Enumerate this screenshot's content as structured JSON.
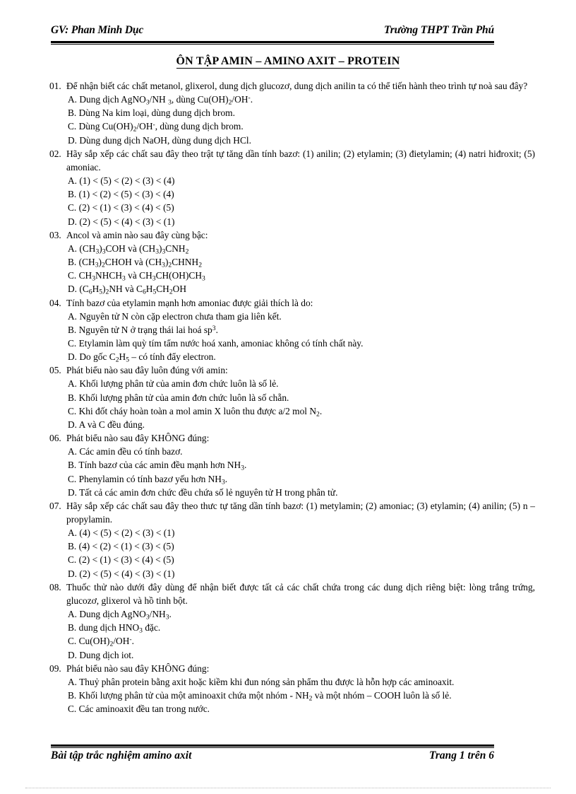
{
  "header": {
    "left": "GV: Phan Minh Dục",
    "right": "Trường THPT Trần Phú"
  },
  "title": "ÔN TẬP AMIN – AMINO AXIT – PROTEIN",
  "footer": {
    "left": "Bài tập trắc nghiệm amino axit",
    "right": "Trang 1 trên 6"
  },
  "questions": [
    {
      "num": "01.",
      "stem": "Để nhận biết các chất metanol,  glixerol,   dung  dịch glucozơ,  dung  dịch anilin  ta có thể tiến  hành theo trình tự noà sau đây?",
      "options": [
        "A. Dung dịch AgNO<sub>3</sub>/NH  <sub>3</sub>, dùng Cu(OH)<sub>2</sub>/OH<sup>-</sup>.",
        "B.  Dùng Na kim loại, dùng dung dịch brom.",
        "C. Dùng Cu(OH)<sub>2</sub>/OH<sup>-</sup>, dùng dung dịch brom.",
        "D. Dùng dung dịch NaOH, dùng dung dịch HCl."
      ]
    },
    {
      "num": "02.",
      "stem": "Hãy sắp xếp các chất sau đây theo trật tự tăng dần tính bazơ: (1) anilin;  (2) etylamin;  (3) đietylamin;   (4) natri hiđroxit;  (5) amoniac.",
      "options": [
        "A. (1) &lt; (5) &lt; (2) &lt; (3) &lt; (4)",
        "B. (1) &lt; (2) &lt; (5) &lt; (3) &lt; (4)",
        "C. (2) &lt; (1) &lt; (3) &lt; (4) &lt; (5)",
        "D. (2) &lt; (5) &lt; (4) &lt; (3) &lt; (1)"
      ]
    },
    {
      "num": "03.",
      "stem": "Ancol và amin nào sau đây cùng bậc:",
      "options": [
        "A. (CH<sub>3</sub>)<sub>3</sub>COH và (CH<sub>3</sub>)<sub>3</sub>CNH<sub>2</sub>",
        "B. (CH<sub>3</sub>)<sub>2</sub>CHOH và (CH<sub>3</sub>)<sub>2</sub>CHNH<sub>2</sub>",
        "C. CH<sub>3</sub>NHCH<sub>3</sub> và CH<sub>3</sub>CH(OH)CH<sub>3</sub>",
        "D. (C<sub>6</sub>H<sub>5</sub>)<sub>2</sub>NH và C<sub>6</sub>H<sub>5</sub>CH<sub>2</sub>OH"
      ]
    },
    {
      "num": "04.",
      "stem": "Tính bazơ của etylamin  mạnh hơn amoniac  được giải thích là do:",
      "options": [
        "A. Nguyên tử N còn cặp electron  chưa tham gia liên kết.",
        "B. Nguyên tử N ở trạng thái lai hoá sp<sup>3</sup>.",
        "C. Etylamin  làm quỳ tím tẩm nước hoá xanh,  amoniac  không có tính  chất này.",
        "D. Do gốc C<sub>2</sub>H<sub>5</sub> – có tính đẩy electron."
      ]
    },
    {
      "num": "05.",
      "stem": "Phát biểu nào sau đây luôn đúng với amin:",
      "options": [
        "A. Khối lượng phân tử của amin  đơn chức luôn là số lẻ.",
        "B.  Khối lượng phân tử của amin  đơn chức luôn  là số chẵn.",
        "C. Khi đốt cháy hoàn toàn a mol  amin  X luôn  thu được a/2 mol  N<sub>2</sub>.",
        "D. A và C đều đúng."
      ]
    },
    {
      "num": "06.",
      "stem": "Phát biểu nào sau đây KHÔNG đúng:",
      "options": [
        "A. Các amin  đều có tính  bazơ.",
        "B. Tính  bazơ của các amin  đều mạnh hơn NH<sub>3</sub>.",
        "C. Phenylamin   có tính  bazơ yếu hơn NH<sub>3</sub>.",
        "D. Tất cả các amin  đơn chức đều chứa số lẻ nguyên  tử H trong phân tử."
      ]
    },
    {
      "num": "07.",
      "stem": "Hãy sắp xếp các chất sau đây theo thưc tự tăng dần tính bazơ: (1) metylamin;   (2) amoniac; (3) etylamin;  (4) anilin;  (5) n – propylamin.",
      "options": [
        "A. (4) &lt; (5) &lt; (2) &lt; (3) &lt; (1)",
        "B. (4) &lt; (2) &lt; (1) &lt; (3) &lt; (5)",
        "C. (2) &lt; (1) &lt; (3) &lt; (4) &lt; (5)",
        "D. (2) &lt; (5) &lt; (4) &lt; (3) &lt; (1)"
      ]
    },
    {
      "num": "08.",
      "stem": "Thuốc thử nào dưới đây dùng để nhận biết được tất cả các chất chứa trong các dung dịch riêng biệt: lòng trắng trứng, glucozơ,  glixerol  và hồ tinh bột.",
      "options": [
        "A. Dung dịch AgNO<sub>3</sub>/NH<sub>3</sub>.",
        "B. dung dịch HNO<sub>3</sub> đặc.",
        "C. Cu(OH)<sub>2</sub>/OH<sup>-</sup>.",
        "D. Dung dịch iot."
      ]
    },
    {
      "num": "09.",
      "stem": "Phát biểu nào sau đây KHÔNG đúng:",
      "options": [
        "A. Thuỷ  phân protein  bằng axit hoặc kiềm  khi đun  nóng  sản phẩm  thu  được là hỗn  hợp  các aminoaxit.",
        "B. Khối lượng phân tử của một aminoaxit   chứa một nhóm  - NH<sub>2</sub> và một nhóm – COOH luôn là số lẻ.",
        "C. Các aminoaxit   đều tan trong nước."
      ]
    }
  ]
}
